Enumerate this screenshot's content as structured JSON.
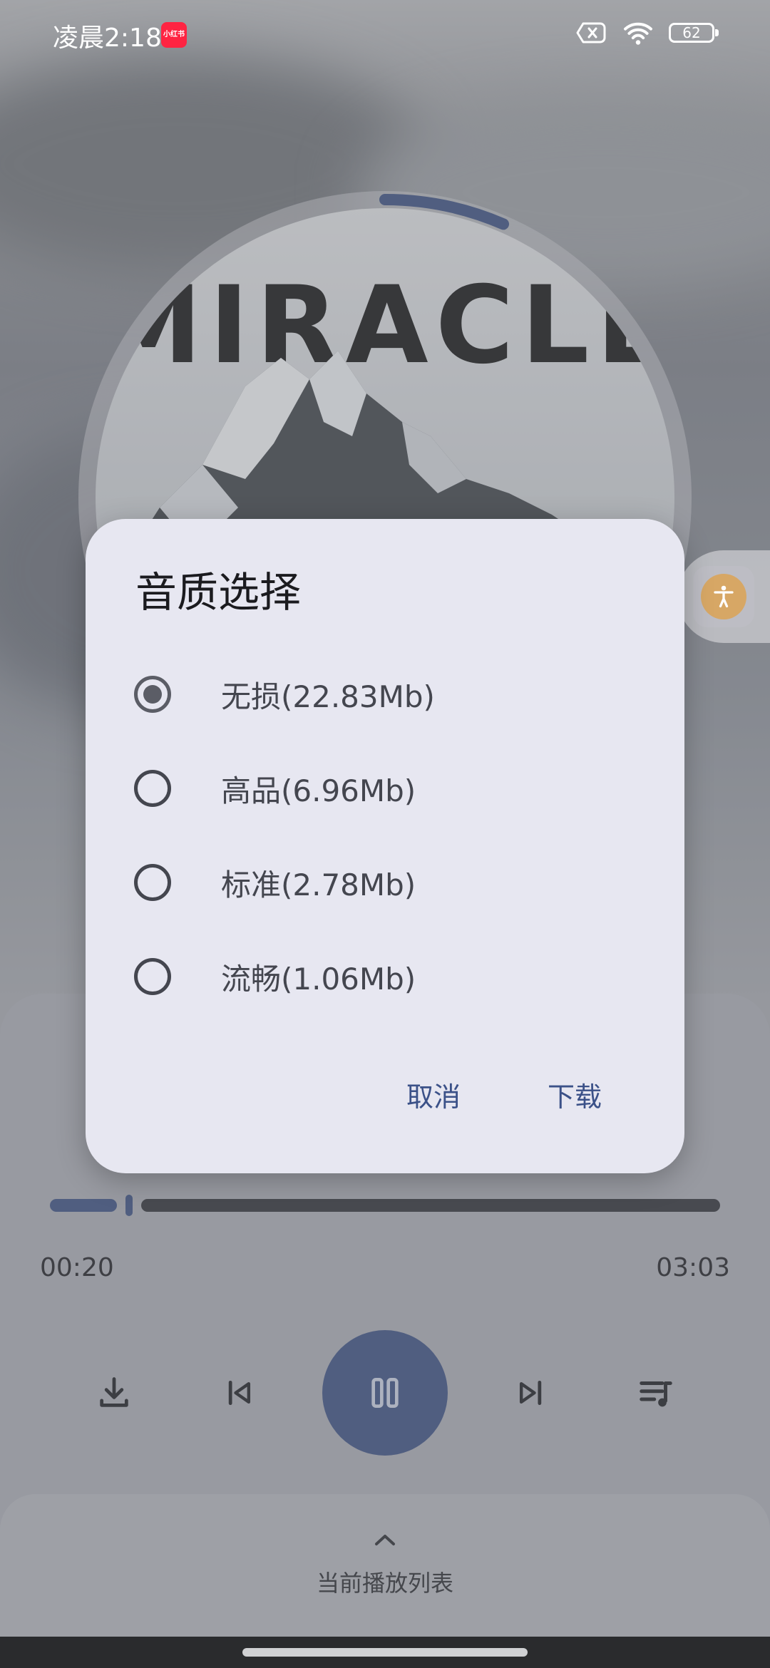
{
  "status_bar": {
    "time": "凌晨2:18",
    "app_badge": "小红书",
    "battery": "62"
  },
  "album": {
    "title": "MIRACLE",
    "progress": 0.065
  },
  "player": {
    "elapsed": "00:20",
    "total": "03:03",
    "progress": 0.11
  },
  "playlist": {
    "label": "当前播放列表"
  },
  "dialog": {
    "title": "音质选择",
    "options": [
      {
        "label": "无损(22.83Mb)",
        "selected": true
      },
      {
        "label": "高品(6.96Mb)",
        "selected": false
      },
      {
        "label": "标准(2.78Mb)",
        "selected": false
      },
      {
        "label": "流畅(1.06Mb)",
        "selected": false
      }
    ],
    "cancel_label": "取消",
    "confirm_label": "下载"
  },
  "colors": {
    "accent": "#3b4f80",
    "dialog_bg": "#e7e7f1",
    "action_text": "#3b5188"
  }
}
